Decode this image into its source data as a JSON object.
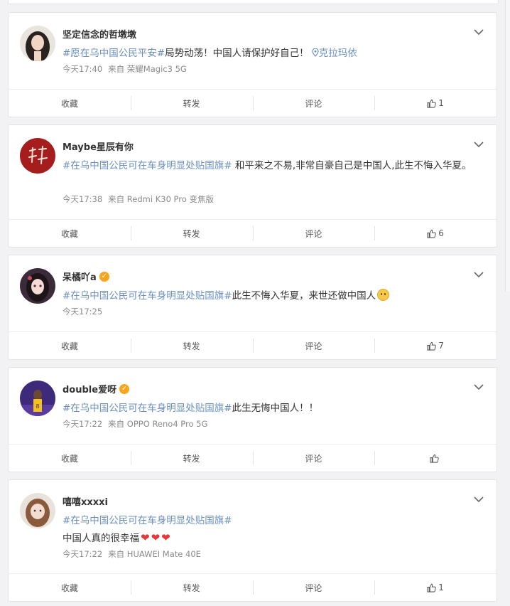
{
  "labels": {
    "collect": "收藏",
    "repost": "转发",
    "comment": "评论"
  },
  "posts": [
    {
      "user": "坚定信念的哲墩墩",
      "verified": false,
      "tag": "#愿在乌中国公民平安#",
      "text": "局势动荡！中国人请保护好自己！",
      "location": "克拉玛依",
      "text2": "",
      "time": "今天17:40",
      "source": "来自 荣耀Magic3 5G",
      "likes": "1"
    },
    {
      "user": "Maybe星辰有你",
      "verified": false,
      "tag": "#在乌中国公民可在车身明显处贴国旗#",
      "text": " 和平来之不易,非常自豪自己是中国人,此生不悔入华夏。",
      "location": "",
      "text2": "",
      "time": "今天17:38",
      "source": "来自 Redmi K30 Pro 变焦版",
      "likes": "6"
    },
    {
      "user": "呆橘吖a",
      "verified": true,
      "tag": "#在乌中国公民可在车身明显处贴国旗#",
      "text": "此生不悔入华夏，来世还做中国人",
      "location": "",
      "text2": "",
      "time": "今天17:25",
      "source": "",
      "likes": "7"
    },
    {
      "user": "double爱呀",
      "verified": true,
      "tag": "#在乌中国公民可在车身明显处贴国旗#",
      "text": "此生无悔中国人！！",
      "location": "",
      "text2": "",
      "time": "今天17:22",
      "source": "来自 OPPO Reno4 Pro 5G",
      "likes": ""
    },
    {
      "user": "嘻嘻xxxxi",
      "verified": false,
      "tag": "#在乌中国公民可在车身明显处贴国旗#",
      "text": "",
      "location": "",
      "text2": "中国人真的很幸福",
      "time": "今天17:22",
      "source": "来自 HUAWEI Mate 40E",
      "likes": "1"
    }
  ]
}
